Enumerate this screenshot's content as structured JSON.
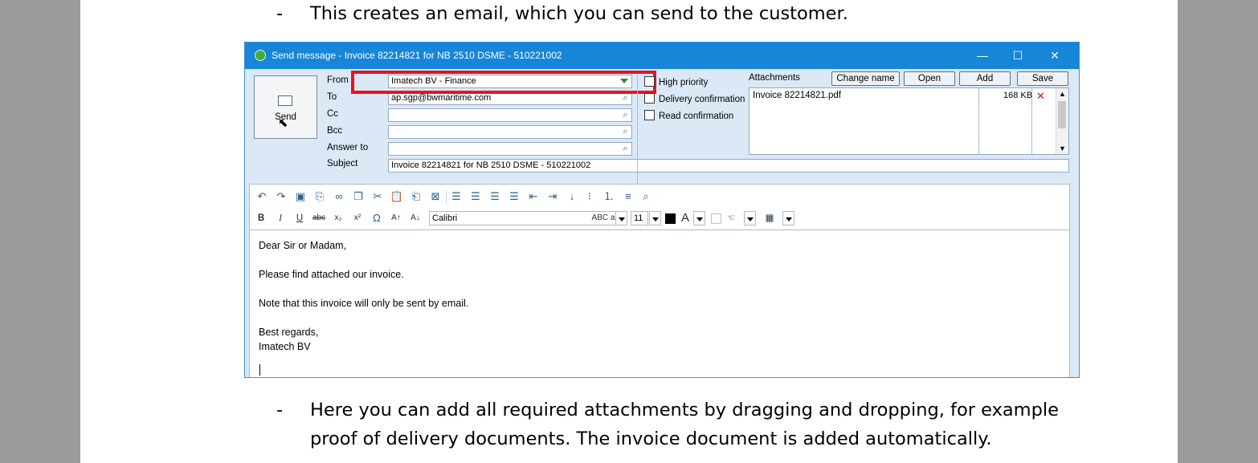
{
  "doc": {
    "bullet1": "This creates an email, which you can send to the customer.",
    "bullet2_line1": "Here you can add all required attachments by dragging and dropping, for example",
    "bullet2_line2": "proof of delivery documents. The invoice document is added automatically.",
    "dash": "-"
  },
  "window": {
    "title": "Send message - Invoice 82214821 for NB 2510 DSME - 510221002",
    "minimize": "—",
    "maximize": "☐",
    "close": "✕"
  },
  "send": {
    "label": "Send"
  },
  "fields": {
    "from_label": "From",
    "from_value": "Imatech BV - Finance",
    "to_label": "To",
    "to_value": "ap.sgp@bwmaritime.com",
    "cc_label": "Cc",
    "bcc_label": "Bcc",
    "answer_label": "Answer to",
    "subject_label": "Subject",
    "subject_value": "Invoice 82214821 for NB 2510 DSME - 510221002"
  },
  "options": {
    "high_priority": "High priority",
    "delivery_confirmation": "Delivery confirmation",
    "read_confirmation": "Read confirmation"
  },
  "attachments": {
    "title": "Attachments",
    "change_name": "Change name",
    "open": "Open",
    "add": "Add",
    "save": "Save",
    "items": [
      {
        "name": "Invoice 82214821.pdf",
        "size": "168 KB"
      }
    ]
  },
  "toolbar": {
    "bold": "B",
    "italic": "I",
    "underline": "U",
    "strike": "abc",
    "subscript": "x₂",
    "superscript": "x²",
    "omega": "Ω",
    "grow": "A↑",
    "shrink": "A↓",
    "font": "Calibri",
    "abc": "ABC abc",
    "size": "11",
    "font_color_letter": "A"
  },
  "body": {
    "line1": "Dear Sir or Madam,",
    "line2": "Please find attached our invoice.",
    "line3": "Note that this invoice will only be sent by email.",
    "line4": "Best regards,",
    "line5": "Imatech BV"
  },
  "colors": {
    "titlebar": "#1786d8",
    "highlight": "#e8141c",
    "window_bg": "#dbe9f7"
  }
}
